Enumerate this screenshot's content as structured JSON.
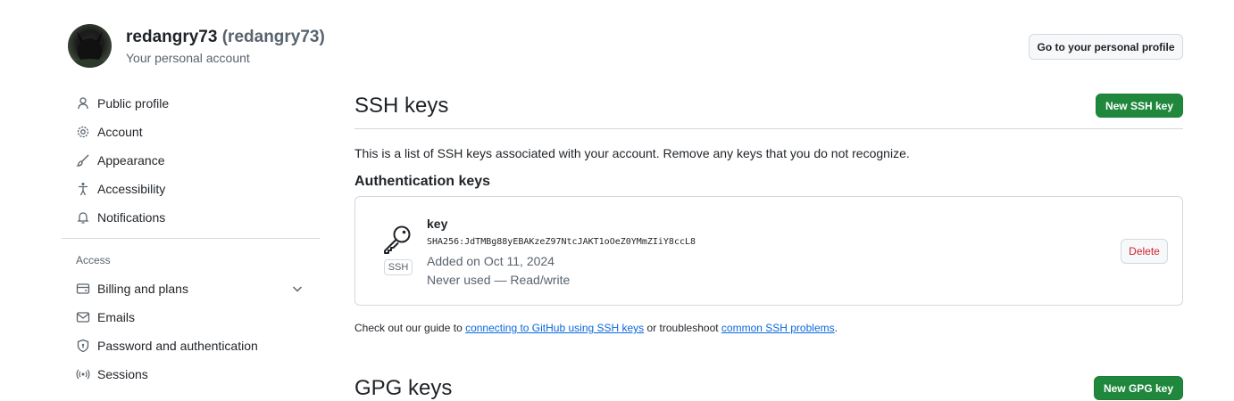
{
  "account": {
    "username": "redangry73",
    "username_paren": "(redangry73)",
    "subtitle": "Your personal account",
    "profile_button": "Go to your personal profile"
  },
  "sidebar": {
    "items": [
      {
        "label": "Public profile",
        "icon": "person-icon"
      },
      {
        "label": "Account",
        "icon": "gear-icon"
      },
      {
        "label": "Appearance",
        "icon": "paintbrush-icon"
      },
      {
        "label": "Accessibility",
        "icon": "accessibility-icon"
      },
      {
        "label": "Notifications",
        "icon": "bell-icon"
      }
    ],
    "access_label": "Access",
    "access_items": [
      {
        "label": "Billing and plans",
        "icon": "credit-card-icon"
      },
      {
        "label": "Emails",
        "icon": "mail-icon"
      },
      {
        "label": "Password and authentication",
        "icon": "shield-lock-icon"
      },
      {
        "label": "Sessions",
        "icon": "broadcast-icon"
      }
    ]
  },
  "main": {
    "title": "SSH keys",
    "new_ssh_button": "New SSH key",
    "description": "This is a list of SSH keys associated with your account. Remove any keys that you do not recognize.",
    "auth_heading": "Authentication keys",
    "key": {
      "badge": "SSH",
      "title": "key",
      "fingerprint": "SHA256:JdTMBg88yEBAKzeZ97NtcJAKT1oOeZ0YMmZIiY8ccL8",
      "added": "Added on Oct 11, 2024",
      "usage": "Never used — Read/write",
      "delete_button": "Delete"
    },
    "footer": {
      "prefix": "Check out our guide to ",
      "link1": "connecting to GitHub using SSH keys",
      "middle": " or troubleshoot ",
      "link2": "common SSH problems",
      "suffix": "."
    },
    "gpg_title": "GPG keys",
    "new_gpg_button": "New GPG key"
  },
  "colors": {
    "primary_button": "#1f883d",
    "danger": "#d1242f",
    "link": "#0969da",
    "border": "#d1d9e0"
  }
}
